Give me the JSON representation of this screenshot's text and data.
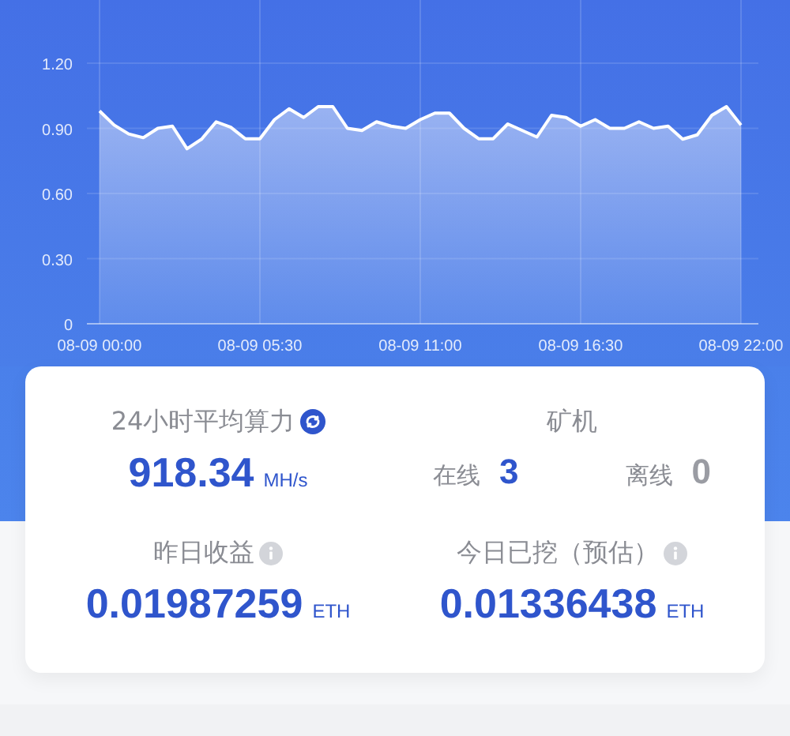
{
  "chart": {
    "chart_data": {
      "type": "area",
      "categories": [
        "08-09 00:00",
        null,
        null,
        null,
        null,
        null,
        null,
        null,
        null,
        null,
        null,
        "08-09 05:30",
        null,
        null,
        null,
        null,
        null,
        null,
        null,
        null,
        null,
        null,
        "08-09 11:00",
        null,
        null,
        null,
        null,
        null,
        null,
        null,
        null,
        null,
        null,
        "08-09 16:30",
        null,
        null,
        null,
        null,
        null,
        null,
        null,
        null,
        null,
        null,
        "08-09 22:00"
      ],
      "series": [
        {
          "color": "#ffffff",
          "values": [
            0.98,
            0.915,
            0.874,
            0.857,
            0.9,
            0.91,
            0.806,
            0.85,
            0.93,
            0.905,
            0.852,
            0.852,
            0.94,
            0.99,
            0.95,
            1.0,
            1.0,
            0.9,
            0.89,
            0.93,
            0.91,
            0.9,
            0.94,
            0.97,
            0.97,
            0.9,
            0.852,
            0.852,
            0.92,
            0.89,
            0.86,
            0.96,
            0.95,
            0.91,
            0.94,
            0.9,
            0.9,
            0.93,
            0.9,
            0.91,
            0.85,
            0.87,
            0.96,
            1.0,
            0.915
          ]
        }
      ],
      "ylim": [
        0,
        1.5
      ],
      "grid": true,
      "yticks": [
        {
          "value": 0,
          "label": "0"
        },
        {
          "value": 0.3,
          "label": "0.30"
        },
        {
          "value": 0.6,
          "label": "0.60"
        },
        {
          "value": 0.9,
          "label": "0.90"
        },
        {
          "value": 1.2,
          "label": "1.20"
        }
      ]
    }
  },
  "stats": {
    "hashrate": {
      "label": "24小时平均算力",
      "value": "918.34",
      "unit": "MH/s"
    },
    "miners": {
      "label": "矿机",
      "items": [
        {
          "label": "在线",
          "value": "3",
          "color": "#2f55cc"
        },
        {
          "label": "离线",
          "value": "0",
          "color": "#9a9ca3"
        }
      ]
    },
    "earnings": [
      {
        "label": "昨日收益",
        "value": "0.01987259",
        "unit": "ETH"
      },
      {
        "label": "今日已挖（预估）",
        "value": "0.01336438",
        "unit": "ETH"
      }
    ]
  }
}
